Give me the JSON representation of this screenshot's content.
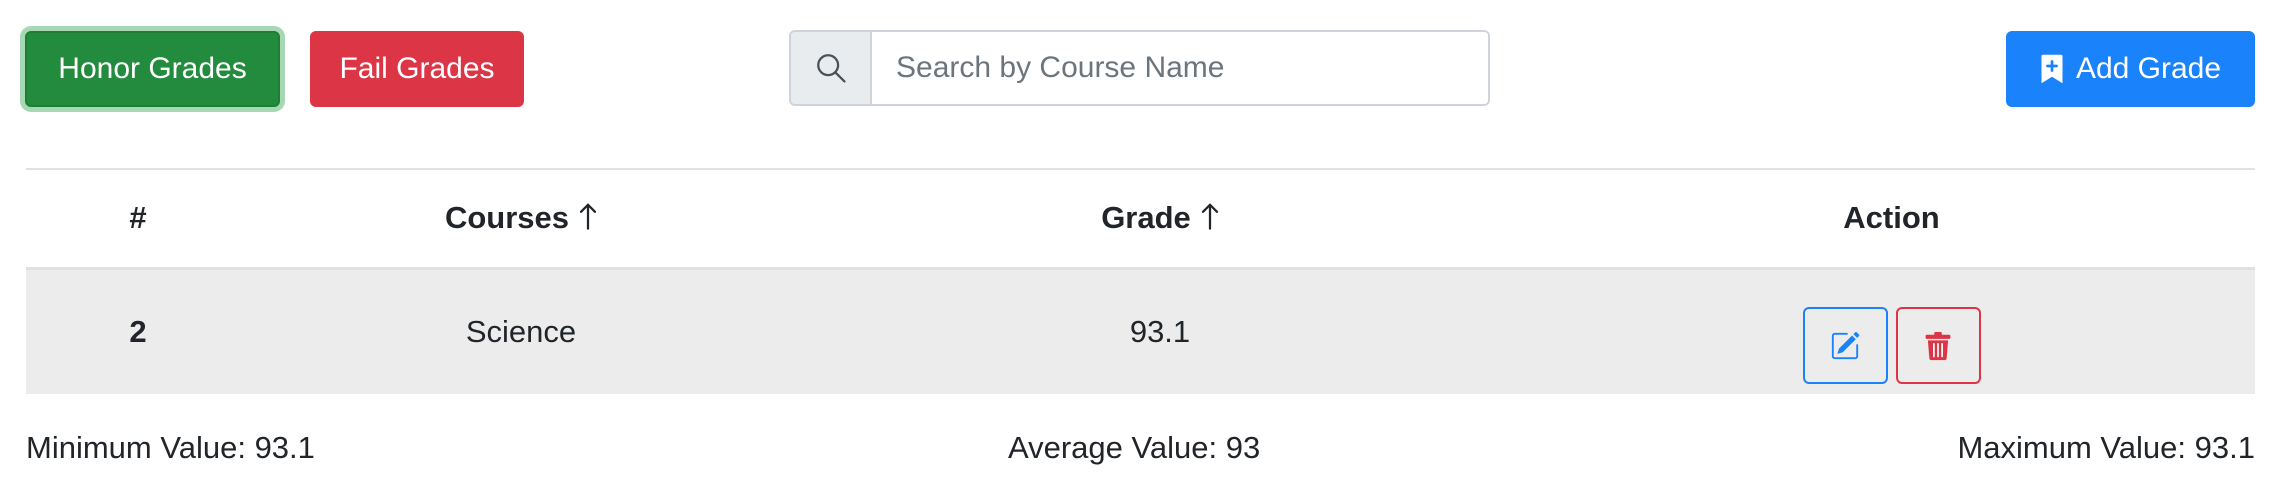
{
  "toolbar": {
    "honor_label": "Honor Grades",
    "fail_label": "Fail Grades",
    "add_label": "Add Grade",
    "search": {
      "placeholder": "Search by Course Name",
      "value": ""
    }
  },
  "table": {
    "headers": {
      "number": "#",
      "courses": "Courses",
      "grade": "Grade",
      "action": "Action"
    },
    "rows": [
      {
        "number": "2",
        "course": "Science",
        "grade": "93.1"
      }
    ]
  },
  "stats": {
    "min_label": "Minimum Value:",
    "min_value": "93.1",
    "avg_label": "Average Value:",
    "avg_value": "93",
    "max_label": "Maximum Value:",
    "max_value": "93.1"
  },
  "icons": {
    "search": "search-icon",
    "add": "bookmark-plus-icon",
    "sort_courses": "arrow-up-icon",
    "sort_grade": "arrow-up-icon",
    "edit": "pencil-square-icon",
    "delete": "trash-icon"
  },
  "colors": {
    "honor": "#228b3e",
    "fail": "#dc3545",
    "primary": "#1a82fb",
    "row_bg": "#ececec"
  }
}
